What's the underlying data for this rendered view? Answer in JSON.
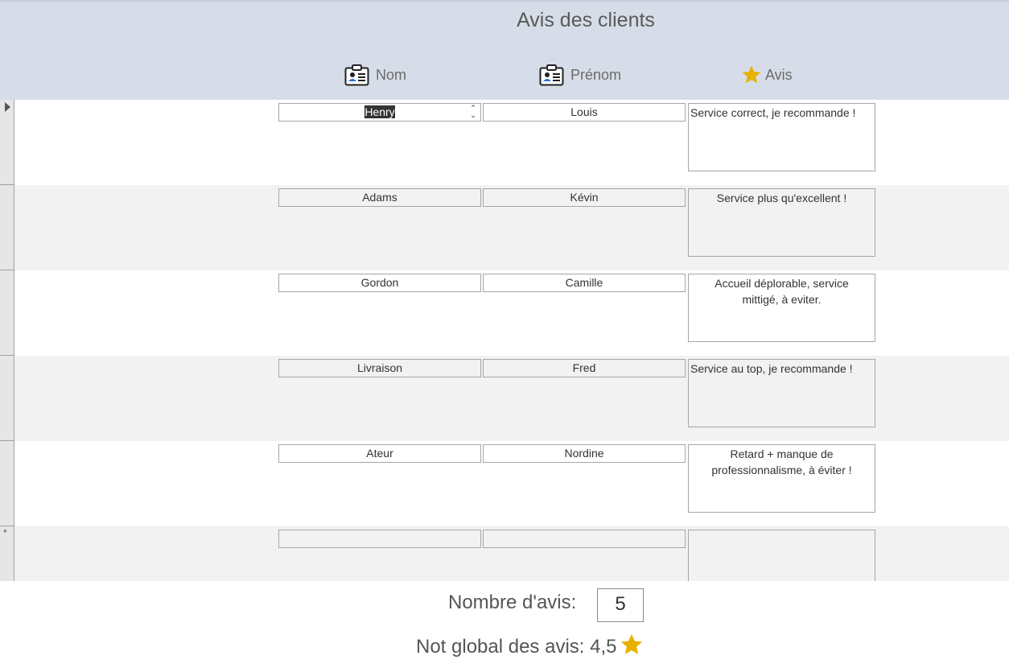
{
  "form": {
    "title": "Avis des clients"
  },
  "columns": {
    "nom": "Nom",
    "prenom": "Prénom",
    "avis": "Avis"
  },
  "icons": {
    "nom": "contact-card-icon",
    "prenom": "contact-card-icon",
    "avis": "star-icon",
    "star_color": "#e8b100"
  },
  "rows": [
    {
      "nom": "Henry",
      "prenom": "Louis",
      "avis": "Service correct, je recommande !"
    },
    {
      "nom": "Adams",
      "prenom": "Kévin",
      "avis": "Service plus qu'excellent !"
    },
    {
      "nom": "Gordon",
      "prenom": "Camille",
      "avis": "Accueil déplorable, service mittigé, à eviter."
    },
    {
      "nom": "Livraison",
      "prenom": "Fred",
      "avis": "Service au top, je recommande !"
    },
    {
      "nom": "Ateur",
      "prenom": "Nordine",
      "avis": "Retard + manque de professionnalisme, à éviter !"
    }
  ],
  "new_record_marker": "*",
  "footer": {
    "count_label": "Nombre d'avis:",
    "count_value": "5",
    "rating_label": "Not global des avis: 4,5"
  }
}
